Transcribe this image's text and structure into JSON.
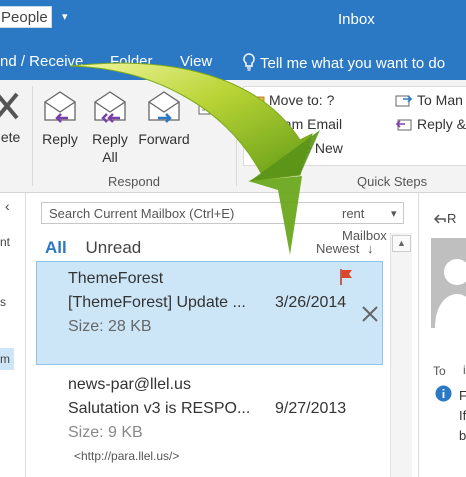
{
  "window": {
    "title": "Inbox",
    "people_label": "People",
    "qa_dropdown": "▾"
  },
  "menu": {
    "send_receive": "nd / Receive",
    "folder": "Folder",
    "view": "View",
    "tell_me": "Tell me what you want to do"
  },
  "ribbon": {
    "delete_label": "lete",
    "reply_label": "Reply",
    "reply_all_label_1": "Reply",
    "reply_all_label_2": "All",
    "forward_label": "Forward",
    "respond_group": "Respond",
    "quick_steps_group": "Quick Steps",
    "quick_steps": [
      "Move to: ?",
      "Team Email",
      "Create New",
      "To Man",
      "Reply &"
    ]
  },
  "search": {
    "placeholder": "Search Current Mailbox (Ctrl+E)",
    "scope": "rent Mailbox"
  },
  "filter": {
    "all": "All",
    "unread": "Unread",
    "sort": "Newest",
    "sort_arrow": "↓"
  },
  "left_pane": {
    "collapse": "‹",
    "items": [
      "nt",
      "s",
      "m"
    ]
  },
  "messages": [
    {
      "sender": "ThemeForest",
      "subject": "[ThemeForest] Update ...",
      "date": "3/26/2014",
      "size": "Size: 28 KB",
      "flag": "flag-icon"
    },
    {
      "sender": "news-par@llel.us",
      "subject": "Salutation v3 is RESPO...",
      "date": "9/27/2013",
      "size": "Size: 9 KB",
      "preview": "<http://para.llel.us/>"
    }
  ],
  "reading_pane": {
    "reply_label": "R",
    "to_label": "To",
    "to_value": "i",
    "info_lines": [
      "Fo",
      "If",
      "b"
    ]
  },
  "colors": {
    "accent": "#2b78c4",
    "selected": "#cde6f7",
    "arrow": "#6aa81e"
  }
}
